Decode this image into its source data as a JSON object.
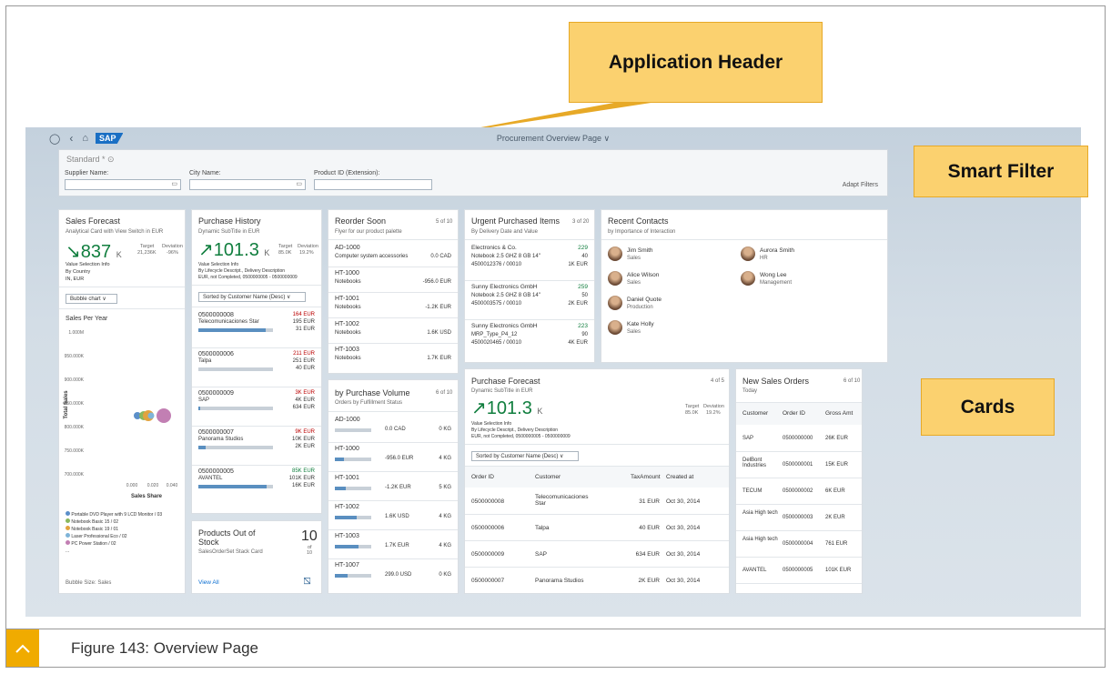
{
  "caption": {
    "text": "Figure 143: Overview Page"
  },
  "callouts": {
    "application_header": "Application Header",
    "smart_filter": "Smart Filter",
    "cards": "Cards"
  },
  "shell": {
    "logo": "SAP",
    "title": "Procurement Overview Page ∨",
    "icons": [
      "person-icon",
      "back-icon",
      "home-icon"
    ]
  },
  "filter": {
    "variant": "Standard * ⊙",
    "supplier_label": "Supplier Name:",
    "city_label": "City Name:",
    "product_label": "Product ID (Extension):",
    "adapt": "Adapt Filters"
  },
  "sales_forecast": {
    "title": "Sales Forecast",
    "subtitle": "Analytical Card with View Switch in EUR",
    "kpi": "837",
    "kpi_unit": "K",
    "target_label": "Target",
    "target_value": "21,236K",
    "deviation_label": "Deviation",
    "deviation_value": "-96%",
    "info1": "Value Selection Info",
    "info2": "By Country",
    "info3": "IN, EUR",
    "dropdown": "Bubble chart",
    "chart_title": "Sales Per Year",
    "y_axis": "Total Sales",
    "y_ticks": [
      "1.000M",
      "950.000K",
      "900.000K",
      "850.000K",
      "800.000K",
      "750.000K",
      "700.000K"
    ],
    "x_ticks": [
      "0.000",
      "0.020",
      "0.040"
    ],
    "x_axis": "Sales Share",
    "legend": [
      {
        "label": "Portable DVD Player with 9 LCD Monitor / 03",
        "color": "#5b8fc9"
      },
      {
        "label": "Notebook Basic 15 / 02",
        "color": "#8ab85d"
      },
      {
        "label": "Notebook Basic 19 / 01",
        "color": "#e2a33e"
      },
      {
        "label": "Laser Professional Eco / 02",
        "color": "#7fb4d8"
      },
      {
        "label": "PC Power Station / 02",
        "color": "#c27fb3"
      }
    ],
    "more": "...",
    "footer": "Bubble Size: Sales"
  },
  "purchase_history": {
    "title": "Purchase History",
    "subtitle": "Dynamic SubTitle in EUR",
    "kpi": "101.3",
    "kpi_unit": "K",
    "target_label": "Target",
    "target_value": "85.0K",
    "deviation_label": "Deviation",
    "deviation_value": "19.2%",
    "info1": "Value Selection Info",
    "info2": "By Lifecycle Descript., Delivery Description",
    "info3": "EUR, not Completed, 0500000005 - 0500000009",
    "dropdown": "Sorted by Customer Name (Desc)",
    "rows": [
      {
        "id": "0500000008",
        "name": "Telecomunicaciones Star",
        "v1": "164 EUR",
        "v2": "195 EUR",
        "v3": "31 EUR",
        "fill": 0.9
      },
      {
        "id": "0500000006",
        "name": "Talpa",
        "v1": "211 EUR",
        "v2": "251 EUR",
        "v3": "40 EUR",
        "fill": 0.0
      },
      {
        "id": "0500000009",
        "name": "SAP",
        "v1": "3K EUR",
        "v2": "4K EUR",
        "v3": "634 EUR",
        "fill": 0.02
      },
      {
        "id": "0500000007",
        "name": "Panorama Studios",
        "v1": "9K EUR",
        "v2": "10K EUR",
        "v3": "2K EUR",
        "fill": 0.1
      },
      {
        "id": "0500000005",
        "name": "AVANTEL",
        "v1": "85K EUR",
        "v2": "101K EUR",
        "v3": "16K EUR",
        "fill": 0.92
      }
    ]
  },
  "products_out": {
    "title1": "Products Out of",
    "title2": "Stock",
    "subtitle": "SalesOrderSet Stack Card",
    "count": "10",
    "of_label": "of",
    "of_value": "10",
    "link": "View All"
  },
  "reorder": {
    "title": "Reorder Soon",
    "count": "5 of 10",
    "subtitle": "Flyer for our product palette",
    "rows": [
      {
        "id": "AD-1000",
        "desc": "Computer system accessories",
        "value": "0.0 CAD"
      },
      {
        "id": "HT-1000",
        "desc": "Notebooks",
        "value": "-956.0 EUR"
      },
      {
        "id": "HT-1001",
        "desc": "Notebooks",
        "value": "-1.2K EUR"
      },
      {
        "id": "HT-1002",
        "desc": "Notebooks",
        "value": "1.6K USD"
      },
      {
        "id": "HT-1003",
        "desc": "Notebooks",
        "value": "1.7K EUR"
      }
    ]
  },
  "by_volume": {
    "title": "by Purchase Volume",
    "count": "6 of 10",
    "subtitle": "Orders by Fulfillment Status",
    "rows": [
      {
        "id": "AD-1000",
        "value": "0.0 CAD",
        "qty": "0 KG",
        "fill": 0.0
      },
      {
        "id": "HT-1000",
        "value": "-956.0 EUR",
        "qty": "4 KG",
        "fill": 0.25
      },
      {
        "id": "HT-1001",
        "value": "-1.2K EUR",
        "qty": "5 KG",
        "fill": 0.3
      },
      {
        "id": "HT-1002",
        "value": "1.6K USD",
        "qty": "4 KG",
        "fill": 0.6
      },
      {
        "id": "HT-1003",
        "value": "1.7K EUR",
        "qty": "4 KG",
        "fill": 0.65
      },
      {
        "id": "HT-1007",
        "value": "299.0 USD",
        "qty": "0 KG",
        "fill": 0.35
      }
    ]
  },
  "urgent": {
    "title": "Urgent Purchased Items",
    "count": "3 of 20",
    "subtitle": "By Delivery Date and Value",
    "rows": [
      {
        "supplier": "Electronics & Co.",
        "item": "Notebook 2.5 GHZ 8 GB 14\"",
        "ref": "4500012376 / 00010",
        "a": "229",
        "b": "40",
        "c": "1K EUR"
      },
      {
        "supplier": "Sunny Electronics GmbH",
        "item": "Notebook 2.5 GHZ 8 GB 14\"",
        "ref": "4500003575 / 00010",
        "a": "259",
        "b": "50",
        "c": "2K EUR"
      },
      {
        "supplier": "Sunny Electronics GmbH",
        "item": "MRP_Type_P4_12",
        "ref": "4500020465 / 00010",
        "a": "223",
        "b": "90",
        "c": "4K EUR"
      }
    ]
  },
  "contacts": {
    "title": "Recent Contacts",
    "subtitle": "by Importance of Interaction",
    "people": [
      {
        "name": "Jim Smith",
        "role": "Sales"
      },
      {
        "name": "Aurora Smith",
        "role": "HR"
      },
      {
        "name": "Alice Wilson",
        "role": "Sales"
      },
      {
        "name": "Wong Lee",
        "role": "Management"
      },
      {
        "name": "Daniel Quote",
        "role": "Production"
      },
      {
        "name": "Kate Holly",
        "role": "Sales"
      }
    ]
  },
  "purchase_forecast": {
    "title": "Purchase Forecast",
    "count": "4 of 5",
    "subtitle": "Dynamic SubTitle in EUR",
    "kpi": "101.3",
    "kpi_unit": "K",
    "target_label": "Target",
    "target_value": "85.0K",
    "deviation_label": "Deviation",
    "deviation_value": "19.2%",
    "info1": "Value Selection Info",
    "info2": "By Lifecycle Descript., Delivery Description",
    "info3": "EUR, not Completed, 0500000005 - 0500000009",
    "dropdown": "Sorted by Customer Name (Desc)",
    "headers": [
      "Order ID",
      "Customer",
      "TaxAmount",
      "Created at"
    ],
    "rows": [
      [
        "0500000008",
        "Telecomunicaciones Star",
        "31 EUR",
        "Oct 30, 2014"
      ],
      [
        "0500000006",
        "Talpa",
        "40 EUR",
        "Oct 30, 2014"
      ],
      [
        "0500000009",
        "SAP",
        "634 EUR",
        "Oct 30, 2014"
      ],
      [
        "0500000007",
        "Panorama Studios",
        "2K EUR",
        "Oct 30, 2014"
      ]
    ]
  },
  "new_sales": {
    "title": "New Sales Orders",
    "count": "6 of 10",
    "subtitle": "Today",
    "headers": [
      "Customer",
      "Order ID",
      "Gross Amt"
    ],
    "rows": [
      [
        "SAP",
        "0500000000",
        "26K EUR"
      ],
      [
        "DelBont Industries",
        "0500000001",
        "15K EUR"
      ],
      [
        "TECUM",
        "0500000002",
        "6K EUR"
      ],
      [
        "Asia High tech",
        "0500000003",
        "2K EUR"
      ],
      [
        "Asia High tech",
        "0500000004",
        "761 EUR"
      ],
      [
        "AVANTEL",
        "0500000005",
        "101K EUR"
      ]
    ]
  }
}
